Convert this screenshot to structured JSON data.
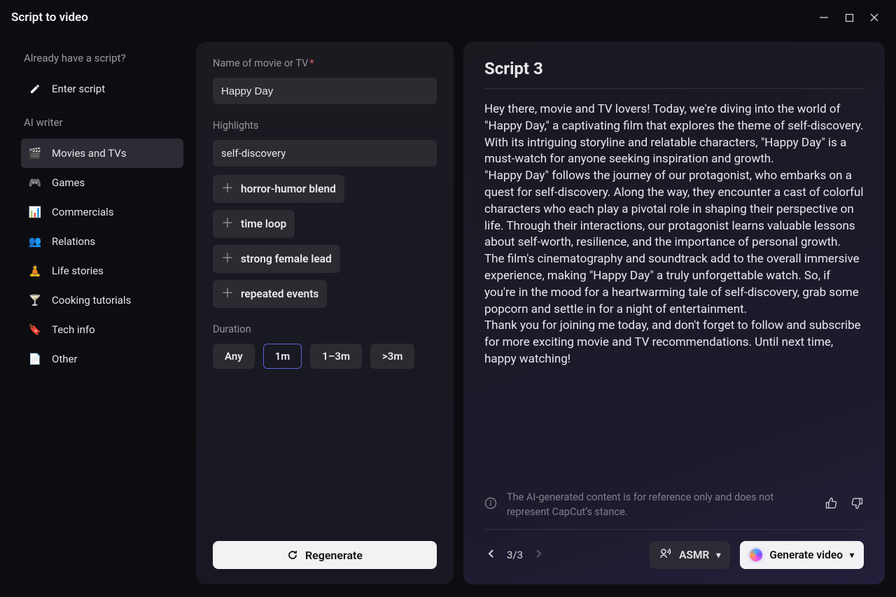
{
  "window": {
    "title": "Script to video"
  },
  "sidebar": {
    "prompt_label": "Already have a script?",
    "enter_script": "Enter script",
    "ai_writer_label": "AI writer",
    "items": [
      {
        "label": "Movies and TVs",
        "icon": "🎬",
        "active": true
      },
      {
        "label": "Games",
        "icon": "🎮",
        "active": false
      },
      {
        "label": "Commercials",
        "icon": "📊",
        "active": false
      },
      {
        "label": "Relations",
        "icon": "👥",
        "active": false
      },
      {
        "label": "Life stories",
        "icon": "🧘",
        "active": false
      },
      {
        "label": "Cooking tutorials",
        "icon": "🍸",
        "active": false
      },
      {
        "label": "Tech info",
        "icon": "🔖",
        "active": false
      },
      {
        "label": "Other",
        "icon": "📄",
        "active": false
      }
    ]
  },
  "form": {
    "name_label": "Name of movie or TV",
    "name_value": "Happy Day",
    "highlights_label": "Highlights",
    "highlights_value": "self-discovery",
    "suggestions": [
      "horror-humor blend",
      "time loop",
      "strong female lead",
      "repeated events"
    ],
    "duration_label": "Duration",
    "durations": [
      "Any",
      "1m",
      "1–3m",
      ">3m"
    ],
    "duration_selected": "1m",
    "regenerate_label": "Regenerate"
  },
  "script": {
    "title": "Script 3",
    "paragraphs": [
      "Hey there, movie and TV lovers! Today, we're diving into the world of \"Happy Day,\" a captivating film that explores the theme of self-discovery. With its intriguing storyline and relatable characters, \"Happy Day\" is a must-watch for anyone seeking inspiration and growth.",
      "\"Happy Day\" follows the journey of our protagonist, who embarks on a quest for self-discovery. Along the way, they encounter a cast of colorful characters who each play a pivotal role in shaping their perspective on life. Through their interactions, our protagonist learns valuable lessons about self-worth, resilience, and the importance of personal growth.",
      "The film's cinematography and soundtrack add to the overall immersive experience, making \"Happy Day\" a truly unforgettable watch. So, if you're in the mood for a heartwarming tale of self-discovery, grab some popcorn and settle in for a night of entertainment.",
      "Thank you for joining me today, and don't forget to follow and subscribe for more exciting movie and TV recommendations. Until next time, happy watching!"
    ],
    "disclaimer": "The AI-generated content is for reference only and does not represent CapCut’s stance.",
    "pager": {
      "current": 3,
      "total": 3,
      "display": "3/3"
    },
    "asmr_label": "ASMR",
    "generate_label": "Generate video"
  }
}
